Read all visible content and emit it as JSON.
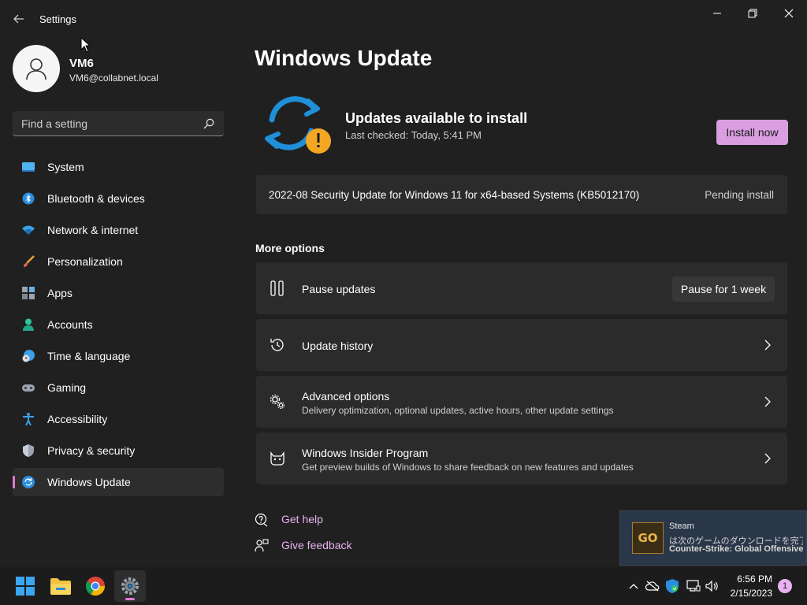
{
  "window": {
    "app_title": "Settings"
  },
  "profile": {
    "name": "VM6",
    "email": "VM6@collabnet.local"
  },
  "search": {
    "placeholder": "Find a setting"
  },
  "sidebar": {
    "items": [
      {
        "label": "System",
        "icon": "monitor-icon",
        "active": false
      },
      {
        "label": "Bluetooth & devices",
        "icon": "bluetooth-icon",
        "active": false
      },
      {
        "label": "Network & internet",
        "icon": "wifi-icon",
        "active": false
      },
      {
        "label": "Personalization",
        "icon": "brush-icon",
        "active": false
      },
      {
        "label": "Apps",
        "icon": "apps-icon",
        "active": false
      },
      {
        "label": "Accounts",
        "icon": "person-icon",
        "active": false
      },
      {
        "label": "Time & language",
        "icon": "globe-clock-icon",
        "active": false
      },
      {
        "label": "Gaming",
        "icon": "gamepad-icon",
        "active": false
      },
      {
        "label": "Accessibility",
        "icon": "accessibility-icon",
        "active": false
      },
      {
        "label": "Privacy & security",
        "icon": "shield-icon",
        "active": false
      },
      {
        "label": "Windows Update",
        "icon": "sync-icon",
        "active": true
      }
    ]
  },
  "main": {
    "title": "Windows Update",
    "status_title": "Updates available to install",
    "status_sub": "Last checked: Today, 5:41 PM",
    "install_button": "Install now",
    "update": {
      "name": "2022-08 Security Update for Windows 11 for x64-based Systems (KB5012170)",
      "status": "Pending install"
    },
    "more_options": "More options",
    "options": [
      {
        "title": "Pause updates",
        "desc": "",
        "button": "Pause for 1 week",
        "icon": "pause-icon"
      },
      {
        "title": "Update history",
        "desc": "",
        "icon": "history-icon"
      },
      {
        "title": "Advanced options",
        "desc": "Delivery optimization, optional updates, active hours, other update settings",
        "icon": "gears-icon"
      },
      {
        "title": "Windows Insider Program",
        "desc": "Get preview builds of Windows to share feedback on new features and updates",
        "icon": "insider-cat-icon"
      }
    ],
    "links": {
      "help": "Get help",
      "feedback": "Give feedback"
    }
  },
  "toast": {
    "app": "Steam",
    "line1": "は次のゲームのダウンロードを完了しま...",
    "line2": "Counter-Strike: Global Offensive",
    "icon_text": "GO"
  },
  "taskbar": {
    "time": "6:56 PM",
    "date": "2/15/2023",
    "notification_count": "1"
  },
  "colors": {
    "accent": "#e07ad4",
    "button_accent": "#d89ee0",
    "link": "#e7b3ee",
    "warning": "#f5a623",
    "sync_blue": "#1e90d8"
  }
}
